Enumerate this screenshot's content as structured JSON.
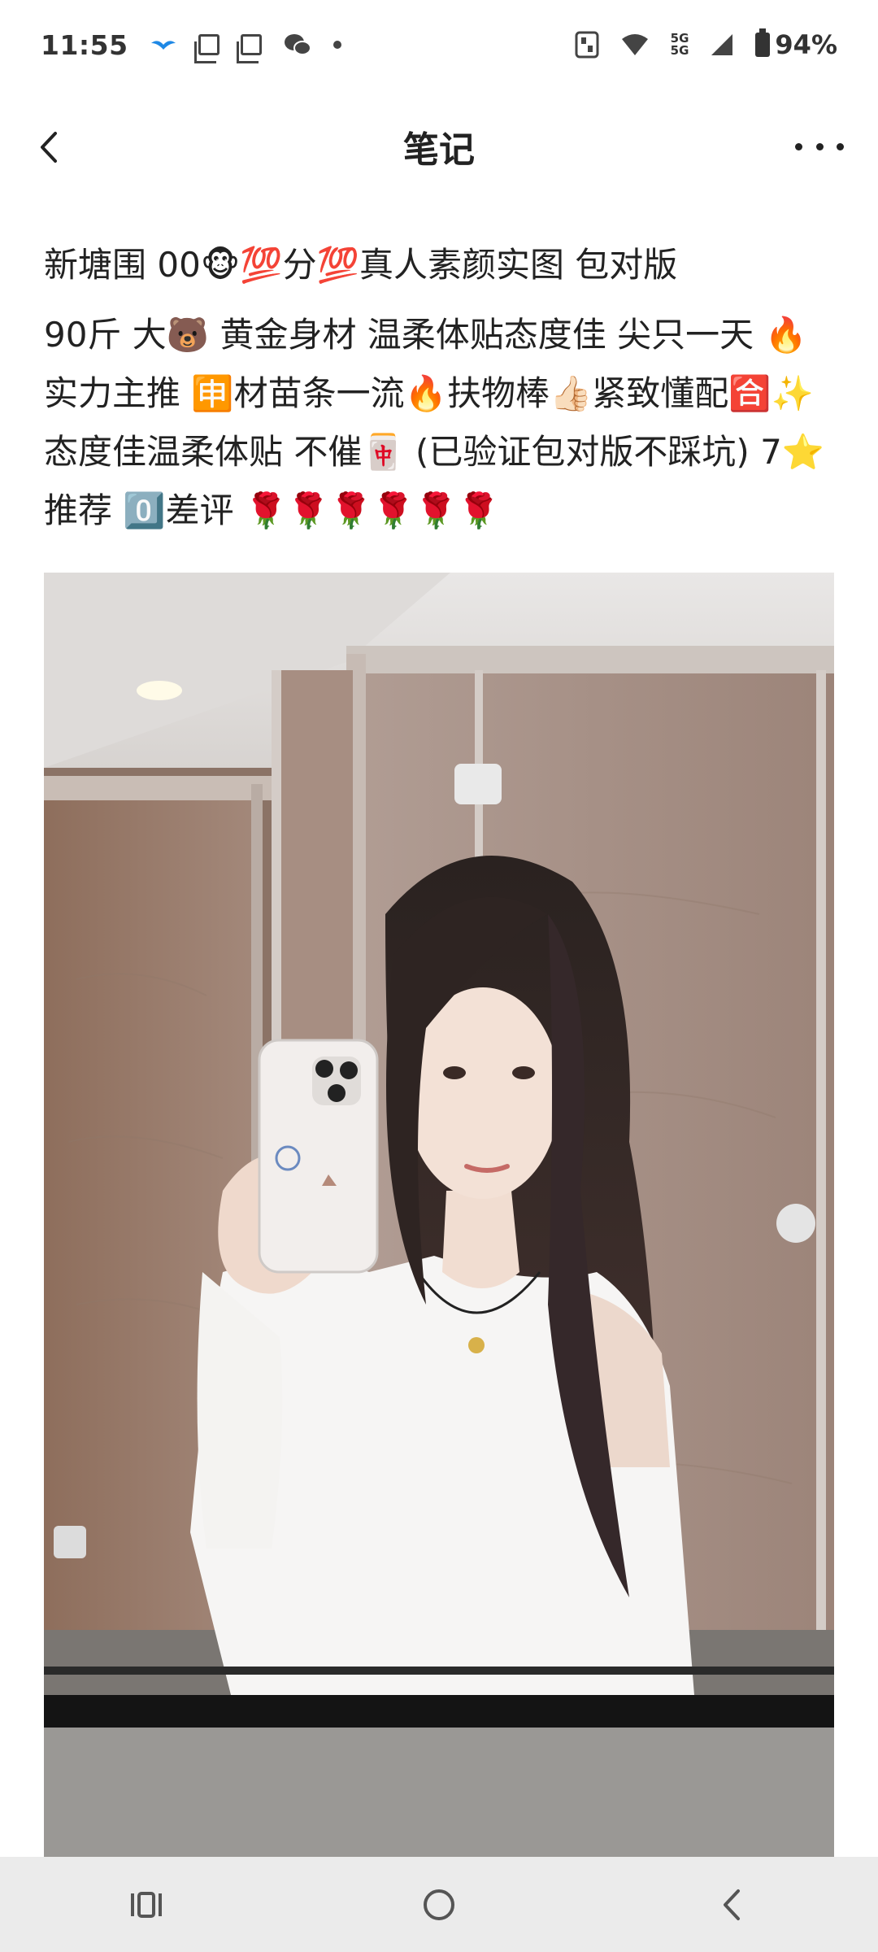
{
  "status_bar": {
    "time": "11:55",
    "network_top": "5G",
    "network_bottom": "5G",
    "battery_label": "94%"
  },
  "header": {
    "title": "笔记"
  },
  "post": {
    "title_line": "新塘围 00🐵💯分💯真人素颜实图 包对版",
    "body": "90斤 大🐻 黄金身材 温柔体贴态度佳 尖只一天 🔥实力主推 🈸材苗条一流🔥扶物棒👍🏻紧致懂配🈴✨态度佳温柔体贴 不催🀄 (已验证包对版不踩坑) 7⭐推荐 0️⃣差评 🌹🌹🌹🌹🌹🌹"
  },
  "icons": {
    "back": "chevron-left-icon",
    "more": "more-dots-icon",
    "nav_recent": "recent-apps-icon",
    "nav_home": "home-icon",
    "nav_back": "nav-back-icon"
  }
}
